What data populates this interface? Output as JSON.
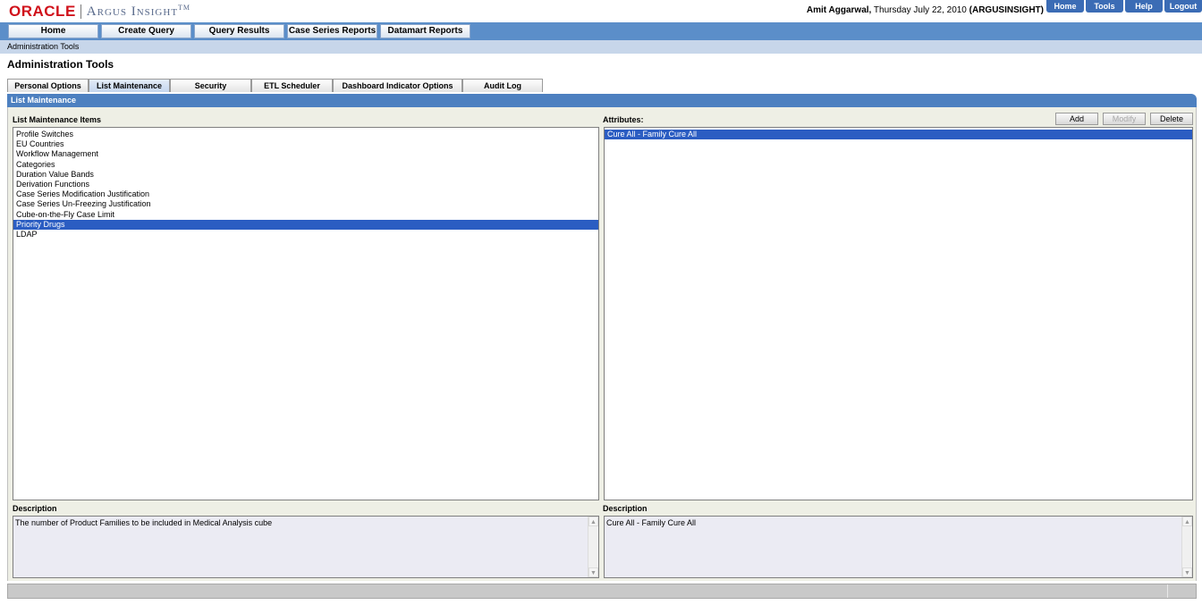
{
  "header": {
    "brand": "ORACLE",
    "product": "Argus Insight",
    "trademark": "TM",
    "user_name": "Amit Aggarwal,",
    "date": "Thursday July 22, 2010",
    "instance": "(ARGUSINSIGHT)",
    "global_links": [
      "Home",
      "Tools",
      "Help",
      "Logout"
    ]
  },
  "nav": {
    "items": [
      "Home",
      "Create Query",
      "Query Results",
      "Case Series Reports",
      "Datamart Reports"
    ]
  },
  "breadcrumb": "Administration Tools",
  "page_title": "Administration Tools",
  "tabs": [
    "Personal Options",
    "List Maintenance",
    "Security",
    "ETL Scheduler",
    "Dashboard Indicator Options",
    "Audit Log"
  ],
  "active_tab": "List Maintenance",
  "section_title": "List Maintenance",
  "left_panel": {
    "label": "List Maintenance Items",
    "items": [
      "Profile Switches",
      "EU Countries",
      "Workflow Management",
      "Categories",
      "Duration Value Bands",
      "Derivation Functions",
      "Case Series Modification Justification",
      "Case Series Un-Freezing Justification",
      "Cube-on-the-Fly Case Limit",
      "Priority Drugs",
      "LDAP"
    ],
    "selected": "Priority Drugs",
    "description_label": "Description",
    "description": "The number of Product Families to be included in Medical Analysis cube"
  },
  "right_panel": {
    "label": "Attributes:",
    "buttons": {
      "add": "Add",
      "modify": "Modify",
      "delete": "Delete"
    },
    "items": [
      "Cure All - Family Cure All"
    ],
    "selected": "Cure All - Family Cure All",
    "description_label": "Description",
    "description": "Cure All - Family Cure All"
  },
  "colors": {
    "brand_red": "#d0121b",
    "nav_blue": "#5b8ec9",
    "section_blue": "#4d80c0",
    "selection_blue": "#2b5dc2"
  }
}
